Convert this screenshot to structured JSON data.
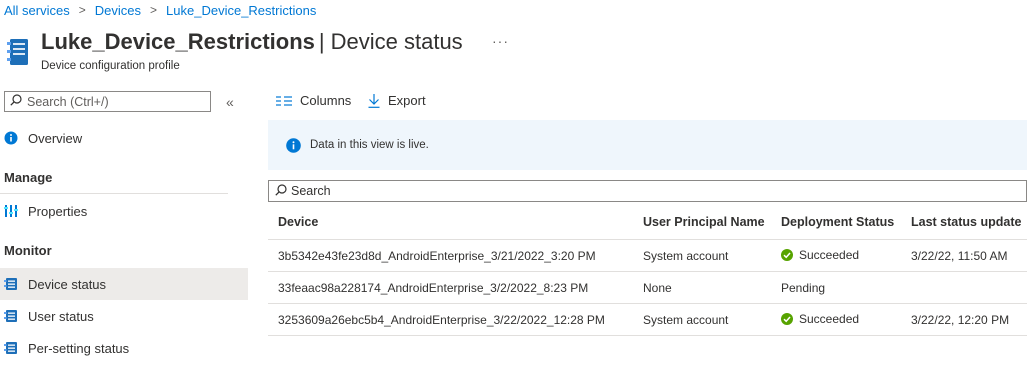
{
  "breadcrumb": {
    "items": [
      "All services",
      "Devices",
      "Luke_Device_Restrictions"
    ],
    "separator": ">"
  },
  "header": {
    "title": "Luke_Device_Restrictions",
    "divider": "|",
    "section": "Device status",
    "subtitle": "Device configuration profile",
    "more": "···"
  },
  "sidebar": {
    "search_placeholder": "Search (Ctrl+/)",
    "collapse": "«",
    "overview": "Overview",
    "sections": [
      {
        "label": "Manage",
        "items": [
          {
            "label": "Properties"
          }
        ]
      },
      {
        "label": "Monitor",
        "items": [
          {
            "label": "Device status"
          },
          {
            "label": "User status"
          },
          {
            "label": "Per-setting status"
          }
        ]
      }
    ]
  },
  "toolbar": {
    "columns_label": "Columns",
    "export_label": "Export"
  },
  "info": {
    "text": "Data in this view is live."
  },
  "grid": {
    "search_placeholder": "Search",
    "columns": [
      "Device",
      "User Principal Name",
      "Deployment Status",
      "Last status update"
    ],
    "rows": [
      {
        "device": "3b5342e43fe23d8d_AndroidEnterprise_3/21/2022_3:20 PM",
        "upn": "System account",
        "status": "Succeeded",
        "updated": "3/22/22, 11:50 AM"
      },
      {
        "device": "33feaac98a228174_AndroidEnterprise_3/2/2022_8:23 PM",
        "upn": "None",
        "status": "Pending",
        "updated": ""
      },
      {
        "device": "3253609a26ebc5b4_AndroidEnterprise_3/22/2022_12:28 PM",
        "upn": "System account",
        "status": "Succeeded",
        "updated": "3/22/22, 12:20 PM"
      }
    ]
  },
  "colors": {
    "link": "#0078d4",
    "success": "#107c10",
    "info_bg": "#eff6fc",
    "selected_bg": "#edebe9"
  }
}
